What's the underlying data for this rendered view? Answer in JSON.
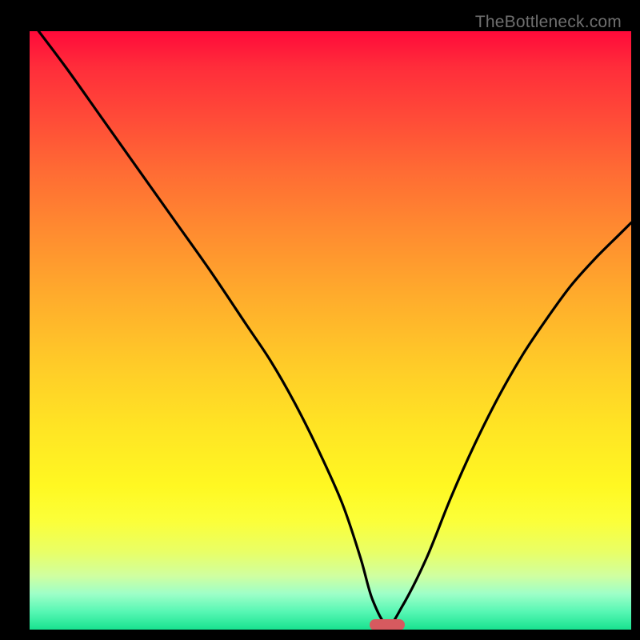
{
  "watermark": "TheBottleneck.com",
  "colors": {
    "marker": "#d65a5f",
    "curve": "#000000"
  },
  "chart_data": {
    "type": "line",
    "title": "",
    "xlabel": "",
    "ylabel": "",
    "xlim": [
      0,
      100
    ],
    "ylim": [
      0,
      100
    ],
    "grid": false,
    "legend": false,
    "annotations": [
      {
        "type": "marker",
        "x": 59.5,
        "y": 0.8,
        "shape": "pill",
        "color": "#d65a5f"
      }
    ],
    "background_gradient": {
      "direction": "vertical",
      "stops": [
        {
          "pos": 0,
          "color": "#ff0a3a"
        },
        {
          "pos": 33,
          "color": "#ff8a30"
        },
        {
          "pos": 66,
          "color": "#ffe424"
        },
        {
          "pos": 100,
          "color": "#18e28f"
        }
      ]
    },
    "series": [
      {
        "name": "bottleneck-curve",
        "x": [
          0,
          6,
          12,
          18,
          24,
          30,
          36,
          40,
          44,
          48,
          52,
          55,
          57,
          59.5,
          62,
          66,
          70,
          74,
          78,
          82,
          86,
          90,
          94,
          98,
          100
        ],
        "values": [
          102,
          94,
          85.5,
          77,
          68.5,
          60,
          51,
          45,
          38,
          30,
          21,
          12,
          5,
          0.8,
          4,
          12,
          22,
          31,
          39,
          46,
          52,
          57.5,
          62,
          66,
          68
        ]
      }
    ]
  }
}
